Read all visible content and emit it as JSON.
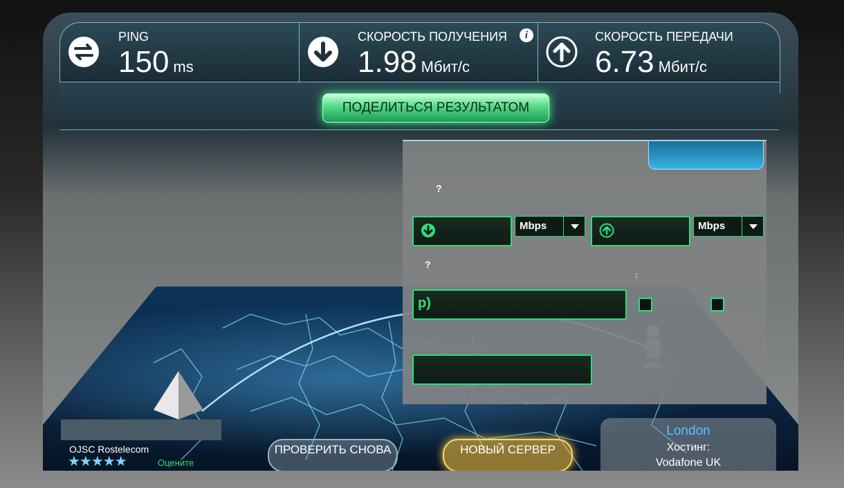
{
  "stats": {
    "ping": {
      "label": "PING",
      "value": "150",
      "unit": "ms"
    },
    "download": {
      "label": "СКОРОСТЬ ПОЛУЧЕНИЯ",
      "value": "1.98",
      "unit": "Мбит/с"
    },
    "upload": {
      "label": "СКОРОСТЬ ПЕРЕДАЧИ",
      "value": "6.73",
      "unit": "Мбит/с"
    }
  },
  "share": {
    "label": "ПОДЕЛИТЬСЯ РЕЗУЛЬТАТОМ"
  },
  "form": {
    "q1": "?",
    "q2": "?",
    "colon": ":",
    "unit_download": "Mbps",
    "unit_upload": "Mbps",
    "price_prefix": "р)"
  },
  "isp": {
    "name": "OJSC Rostelecom",
    "stars": "★★★★★",
    "rate_label": "Оцените"
  },
  "buttons": {
    "retest": "ПРОВЕРИТЬ СНОВА",
    "new_server": "НОВЫЙ СЕРВЕР"
  },
  "host": {
    "city": "London",
    "label": "Хостинг:",
    "name": "Vodafone UK"
  },
  "colors": {
    "accent_green": "#2be07b",
    "accent_blue": "#4fc6ff",
    "accent_gold": "#ffd86a"
  }
}
